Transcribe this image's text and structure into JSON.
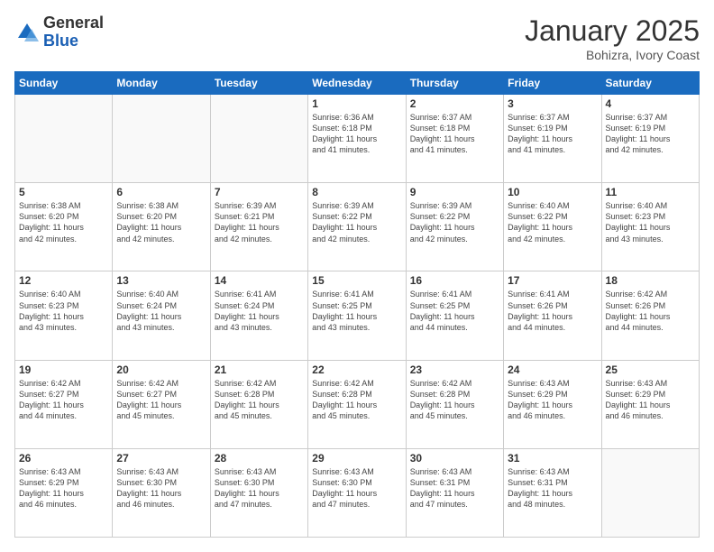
{
  "logo": {
    "general": "General",
    "blue": "Blue"
  },
  "header": {
    "month": "January 2025",
    "location": "Bohizra, Ivory Coast"
  },
  "weekdays": [
    "Sunday",
    "Monday",
    "Tuesday",
    "Wednesday",
    "Thursday",
    "Friday",
    "Saturday"
  ],
  "weeks": [
    [
      {
        "day": "",
        "info": ""
      },
      {
        "day": "",
        "info": ""
      },
      {
        "day": "",
        "info": ""
      },
      {
        "day": "1",
        "info": "Sunrise: 6:36 AM\nSunset: 6:18 PM\nDaylight: 11 hours\nand 41 minutes."
      },
      {
        "day": "2",
        "info": "Sunrise: 6:37 AM\nSunset: 6:18 PM\nDaylight: 11 hours\nand 41 minutes."
      },
      {
        "day": "3",
        "info": "Sunrise: 6:37 AM\nSunset: 6:19 PM\nDaylight: 11 hours\nand 41 minutes."
      },
      {
        "day": "4",
        "info": "Sunrise: 6:37 AM\nSunset: 6:19 PM\nDaylight: 11 hours\nand 42 minutes."
      }
    ],
    [
      {
        "day": "5",
        "info": "Sunrise: 6:38 AM\nSunset: 6:20 PM\nDaylight: 11 hours\nand 42 minutes."
      },
      {
        "day": "6",
        "info": "Sunrise: 6:38 AM\nSunset: 6:20 PM\nDaylight: 11 hours\nand 42 minutes."
      },
      {
        "day": "7",
        "info": "Sunrise: 6:39 AM\nSunset: 6:21 PM\nDaylight: 11 hours\nand 42 minutes."
      },
      {
        "day": "8",
        "info": "Sunrise: 6:39 AM\nSunset: 6:22 PM\nDaylight: 11 hours\nand 42 minutes."
      },
      {
        "day": "9",
        "info": "Sunrise: 6:39 AM\nSunset: 6:22 PM\nDaylight: 11 hours\nand 42 minutes."
      },
      {
        "day": "10",
        "info": "Sunrise: 6:40 AM\nSunset: 6:22 PM\nDaylight: 11 hours\nand 42 minutes."
      },
      {
        "day": "11",
        "info": "Sunrise: 6:40 AM\nSunset: 6:23 PM\nDaylight: 11 hours\nand 43 minutes."
      }
    ],
    [
      {
        "day": "12",
        "info": "Sunrise: 6:40 AM\nSunset: 6:23 PM\nDaylight: 11 hours\nand 43 minutes."
      },
      {
        "day": "13",
        "info": "Sunrise: 6:40 AM\nSunset: 6:24 PM\nDaylight: 11 hours\nand 43 minutes."
      },
      {
        "day": "14",
        "info": "Sunrise: 6:41 AM\nSunset: 6:24 PM\nDaylight: 11 hours\nand 43 minutes."
      },
      {
        "day": "15",
        "info": "Sunrise: 6:41 AM\nSunset: 6:25 PM\nDaylight: 11 hours\nand 43 minutes."
      },
      {
        "day": "16",
        "info": "Sunrise: 6:41 AM\nSunset: 6:25 PM\nDaylight: 11 hours\nand 44 minutes."
      },
      {
        "day": "17",
        "info": "Sunrise: 6:41 AM\nSunset: 6:26 PM\nDaylight: 11 hours\nand 44 minutes."
      },
      {
        "day": "18",
        "info": "Sunrise: 6:42 AM\nSunset: 6:26 PM\nDaylight: 11 hours\nand 44 minutes."
      }
    ],
    [
      {
        "day": "19",
        "info": "Sunrise: 6:42 AM\nSunset: 6:27 PM\nDaylight: 11 hours\nand 44 minutes."
      },
      {
        "day": "20",
        "info": "Sunrise: 6:42 AM\nSunset: 6:27 PM\nDaylight: 11 hours\nand 45 minutes."
      },
      {
        "day": "21",
        "info": "Sunrise: 6:42 AM\nSunset: 6:28 PM\nDaylight: 11 hours\nand 45 minutes."
      },
      {
        "day": "22",
        "info": "Sunrise: 6:42 AM\nSunset: 6:28 PM\nDaylight: 11 hours\nand 45 minutes."
      },
      {
        "day": "23",
        "info": "Sunrise: 6:42 AM\nSunset: 6:28 PM\nDaylight: 11 hours\nand 45 minutes."
      },
      {
        "day": "24",
        "info": "Sunrise: 6:43 AM\nSunset: 6:29 PM\nDaylight: 11 hours\nand 46 minutes."
      },
      {
        "day": "25",
        "info": "Sunrise: 6:43 AM\nSunset: 6:29 PM\nDaylight: 11 hours\nand 46 minutes."
      }
    ],
    [
      {
        "day": "26",
        "info": "Sunrise: 6:43 AM\nSunset: 6:29 PM\nDaylight: 11 hours\nand 46 minutes."
      },
      {
        "day": "27",
        "info": "Sunrise: 6:43 AM\nSunset: 6:30 PM\nDaylight: 11 hours\nand 46 minutes."
      },
      {
        "day": "28",
        "info": "Sunrise: 6:43 AM\nSunset: 6:30 PM\nDaylight: 11 hours\nand 47 minutes."
      },
      {
        "day": "29",
        "info": "Sunrise: 6:43 AM\nSunset: 6:30 PM\nDaylight: 11 hours\nand 47 minutes."
      },
      {
        "day": "30",
        "info": "Sunrise: 6:43 AM\nSunset: 6:31 PM\nDaylight: 11 hours\nand 47 minutes."
      },
      {
        "day": "31",
        "info": "Sunrise: 6:43 AM\nSunset: 6:31 PM\nDaylight: 11 hours\nand 48 minutes."
      },
      {
        "day": "",
        "info": ""
      }
    ]
  ]
}
